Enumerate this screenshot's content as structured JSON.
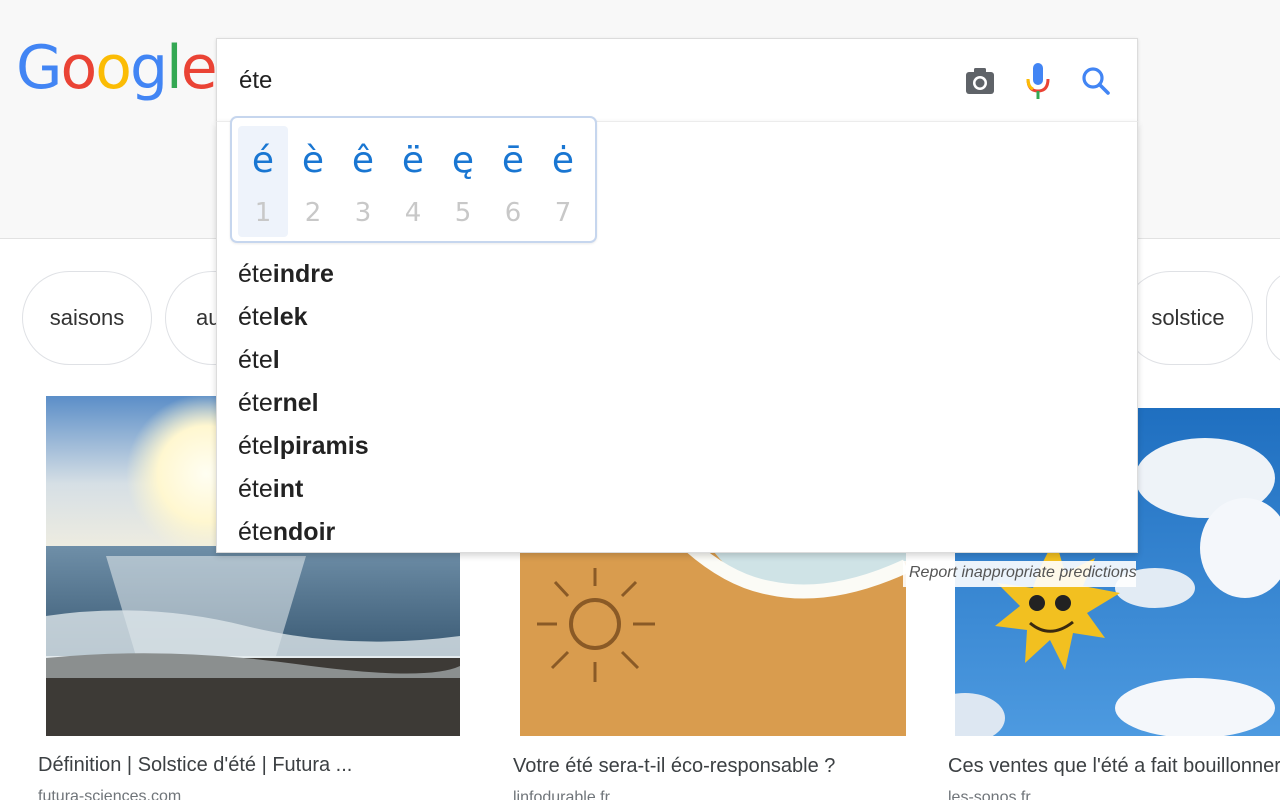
{
  "logo": {
    "letters": [
      {
        "char": "G",
        "color": "#4285F4"
      },
      {
        "char": "o",
        "color": "#EA4335"
      },
      {
        "char": "o",
        "color": "#FBBC05"
      },
      {
        "char": "g",
        "color": "#4285F4"
      },
      {
        "char": "l",
        "color": "#34A853"
      },
      {
        "char": "e",
        "color": "#EA4335"
      }
    ]
  },
  "search": {
    "value": "éte",
    "icons": {
      "camera": "camera-icon",
      "mic": "microphone-icon",
      "search": "search-icon"
    }
  },
  "accent_popup": {
    "selected_index": 0,
    "items": [
      {
        "char": "é",
        "num": "1"
      },
      {
        "char": "è",
        "num": "2"
      },
      {
        "char": "ê",
        "num": "3"
      },
      {
        "char": "ë",
        "num": "4"
      },
      {
        "char": "ę",
        "num": "5"
      },
      {
        "char": "ē",
        "num": "6"
      },
      {
        "char": "ė",
        "num": "7"
      }
    ]
  },
  "suggestions": [
    {
      "prefix": "éte",
      "completion": "indre"
    },
    {
      "prefix": "éte",
      "completion": "lek"
    },
    {
      "prefix": "éte",
      "completion": "l"
    },
    {
      "prefix": "éte",
      "completion": "rnel"
    },
    {
      "prefix": "éte",
      "completion": "lpiramis"
    },
    {
      "prefix": "éte",
      "completion": "int"
    },
    {
      "prefix": "éte",
      "completion": "ndoir"
    }
  ],
  "report_link": "Report inappropriate predictions",
  "chips": [
    "saisons",
    "au",
    "solstice"
  ],
  "cards": [
    {
      "title": "Définition | Solstice d'été | Futura ...",
      "source": "futura-sciences.com"
    },
    {
      "title": "Votre été sera-t-il éco-responsable ?",
      "source": "linfodurable.fr"
    },
    {
      "title": "Ces ventes que l'été a fait bouillonner !",
      "source": "les-sonos.fr"
    }
  ],
  "colors": {
    "accent_blue": "#1976d2",
    "popup_border": "#c6d6ee"
  }
}
